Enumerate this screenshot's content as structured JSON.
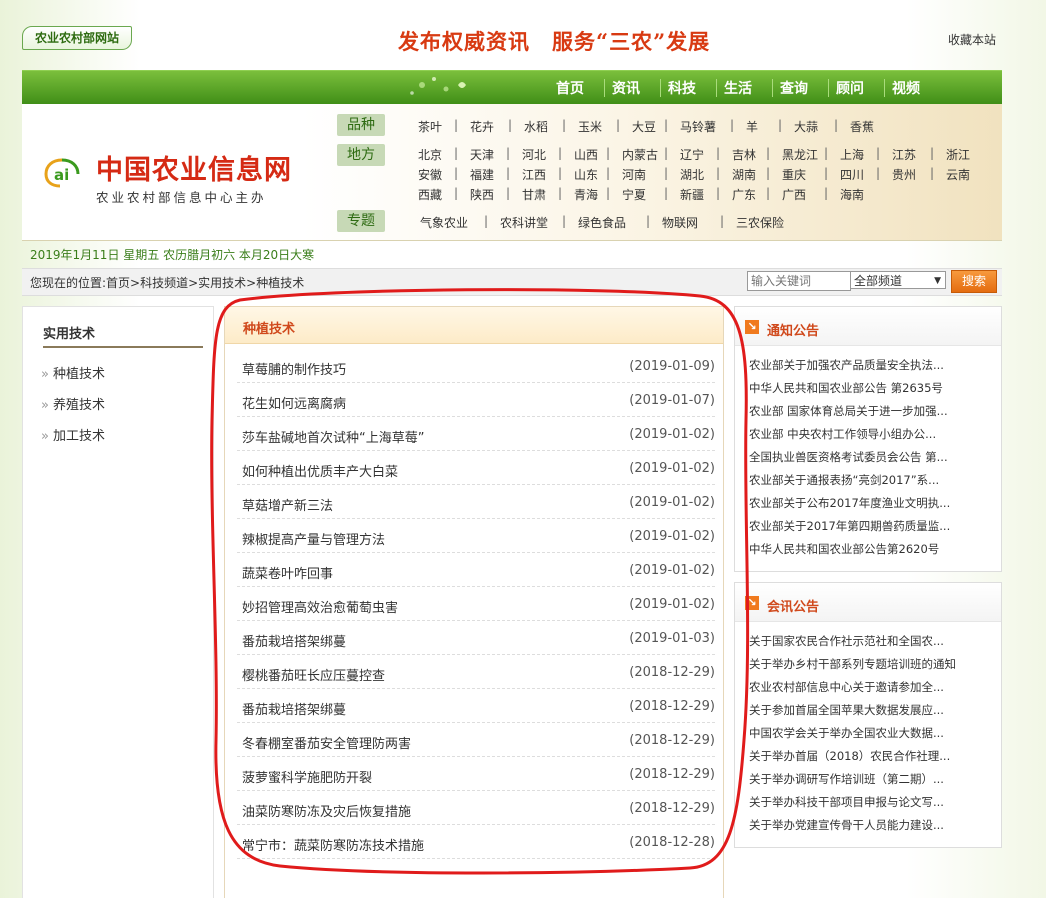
{
  "header": {
    "badge": "农业农村部网站",
    "slogan": "发布权威资讯　服务“三农”发展",
    "favorite": "收藏本站"
  },
  "nav": [
    "首页",
    "资讯",
    "科技",
    "生活",
    "查询",
    "顾问",
    "视频"
  ],
  "logo": {
    "title": "中国农业信息网",
    "subtitle": "农业农村部信息中心主办"
  },
  "categories": {
    "variety_label": "品种",
    "varieties": [
      "茶叶",
      "花卉",
      "水稻",
      "玉米",
      "大豆",
      "马铃薯",
      "羊",
      "大蒜",
      "香蕉"
    ],
    "region_label": "地方",
    "regions_row1": [
      "北京",
      "天津",
      "河北",
      "山西",
      "内蒙古",
      "辽宁",
      "吉林",
      "黑龙江",
      "上海",
      "江苏",
      "浙江"
    ],
    "regions_row2": [
      "安徽",
      "福建",
      "江西",
      "山东",
      "河南",
      "湖北",
      "湖南",
      "重庆",
      "四川",
      "贵州",
      "云南"
    ],
    "regions_row3": [
      "西藏",
      "陕西",
      "甘肃",
      "青海",
      "宁夏",
      "新疆",
      "广东",
      "广西",
      "海南"
    ],
    "topic_label": "专题",
    "topics": [
      "气象农业",
      "农科讲堂",
      "绿色食品",
      "物联网",
      "三农保险"
    ]
  },
  "date_line": "2019年1月11日 星期五 农历腊月初六 本月20日大寒",
  "location": "您现在的位置:首页>科技频道>实用技术>种植技术",
  "search": {
    "placeholder": "输入关键词",
    "scope": "全部频道",
    "button": "搜索"
  },
  "sidebar": {
    "title": "实用技术",
    "items": [
      "种植技术",
      "养殖技术",
      "加工技术"
    ]
  },
  "main": {
    "title": "种植技术",
    "articles": [
      {
        "title": "草莓脯的制作技巧",
        "date": "(2019-01-09)"
      },
      {
        "title": "花生如何远离腐病",
        "date": "(2019-01-07)"
      },
      {
        "title": "莎车盐碱地首次试种“上海草莓”",
        "date": "(2019-01-02)"
      },
      {
        "title": "如何种植出优质丰产大白菜",
        "date": "(2019-01-02)"
      },
      {
        "title": "草菇增产新三法",
        "date": "(2019-01-02)"
      },
      {
        "title": "辣椒提高产量与管理方法",
        "date": "(2019-01-02)"
      },
      {
        "title": "蔬菜卷叶咋回事",
        "date": "(2019-01-02)"
      },
      {
        "title": "妙招管理高效治愈葡萄虫害",
        "date": "(2019-01-02)"
      },
      {
        "title": "番茄栽培搭架绑蔓",
        "date": "(2019-01-03)"
      },
      {
        "title": "樱桃番茄旺长应压蔓控查",
        "date": "(2018-12-29)"
      },
      {
        "title": "番茄栽培搭架绑蔓",
        "date": "(2018-12-29)"
      },
      {
        "title": "冬春棚室番茄安全管理防两害",
        "date": "(2018-12-29)"
      },
      {
        "title": "菠萝蜜科学施肥防开裂",
        "date": "(2018-12-29)"
      },
      {
        "title": "油菜防寒防冻及灾后恢复措施",
        "date": "(2018-12-29)"
      },
      {
        "title": "常宁市：蔬菜防寒防冻技术措施",
        "date": "(2018-12-28)"
      }
    ]
  },
  "notices": {
    "title": "通知公告",
    "items": [
      "农业部关于加强农产品质量安全执法...",
      "中华人民共和国农业部公告 第2635号",
      "农业部 国家体育总局关于进一步加强...",
      "农业部 中央农村工作领导小组办公...",
      "全国执业兽医资格考试委员会公告 第...",
      "农业部关于通报表扬“亮剑2017”系...",
      "农业部关于公布2017年度渔业文明执...",
      "农业部关于2017年第四期兽药质量监...",
      "中华人民共和国农业部公告第2620号"
    ]
  },
  "meetings": {
    "title": "会讯公告",
    "items": [
      "关于国家农民合作社示范社和全国农...",
      "关于举办乡村干部系列专题培训班的通知",
      "农业农村部信息中心关于邀请参加全...",
      "关于参加首届全国苹果大数据发展应...",
      "中国农学会关于举办全国农业大数据...",
      "关于举办首届（2018）农民合作社理...",
      "关于举办调研写作培训班（第二期）...",
      "关于举办科技干部项目申报与论文写...",
      "关于举办党建宣传骨干人员能力建设..."
    ]
  },
  "colors": {
    "brand_green": "#4a9a1c",
    "accent_orange": "#d0491c",
    "slogan_red": "#d83a12",
    "annotation_red": "#e01b1b"
  }
}
